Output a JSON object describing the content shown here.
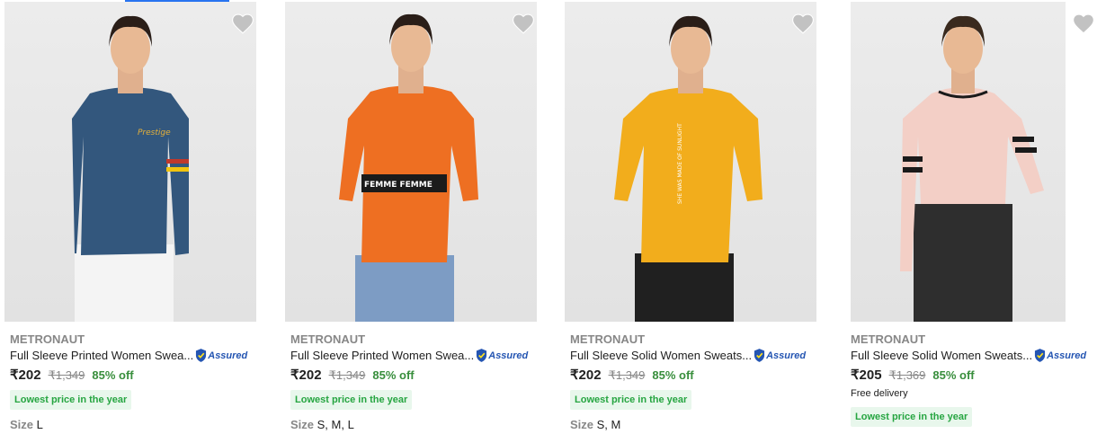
{
  "colors": {
    "accent": "#2874f0",
    "discount": "#388e3c",
    "badge_bg": "#e8f7ec",
    "assured": "#2455b2"
  },
  "products": [
    {
      "brand": "METRONAUT",
      "title": "Full Sleeve Printed Women Swea...",
      "assured": "Assured",
      "price": "₹202",
      "mrp": "₹1,349",
      "discount": "85% off",
      "badge": "Lowest price in the year",
      "size_label": "Size",
      "sizes": "L",
      "shirt_color": "#33577d",
      "shirt_text": "Prestige",
      "pants_color": "#f4f4f4"
    },
    {
      "brand": "METRONAUT",
      "title": "Full Sleeve Printed Women Swea...",
      "assured": "Assured",
      "price": "₹202",
      "mrp": "₹1,349",
      "discount": "85% off",
      "badge": "Lowest price in the year",
      "size_label": "Size",
      "sizes": "S, M, L",
      "shirt_color": "#ee6f22",
      "shirt_text": "FEMME  FEMME",
      "pants_color": "#7d9cc4"
    },
    {
      "brand": "METRONAUT",
      "title": "Full Sleeve Solid Women Sweats...",
      "assured": "Assured",
      "price": "₹202",
      "mrp": "₹1,349",
      "discount": "85% off",
      "badge": "Lowest price in the year",
      "size_label": "Size",
      "sizes": "S, M",
      "shirt_color": "#f2ad1c",
      "shirt_text": "SHE WAS MADE OF SUNLIGHT",
      "pants_color": "#202020"
    },
    {
      "brand": "METRONAUT",
      "title": "Full Sleeve Solid Women Sweats...",
      "assured": "Assured",
      "price": "₹205",
      "mrp": "₹1,369",
      "discount": "85% off",
      "free_delivery": "Free delivery",
      "badge": "Lowest price in the year",
      "shirt_color": "#f3cfc6",
      "pants_color": "#2e2e2e"
    }
  ]
}
